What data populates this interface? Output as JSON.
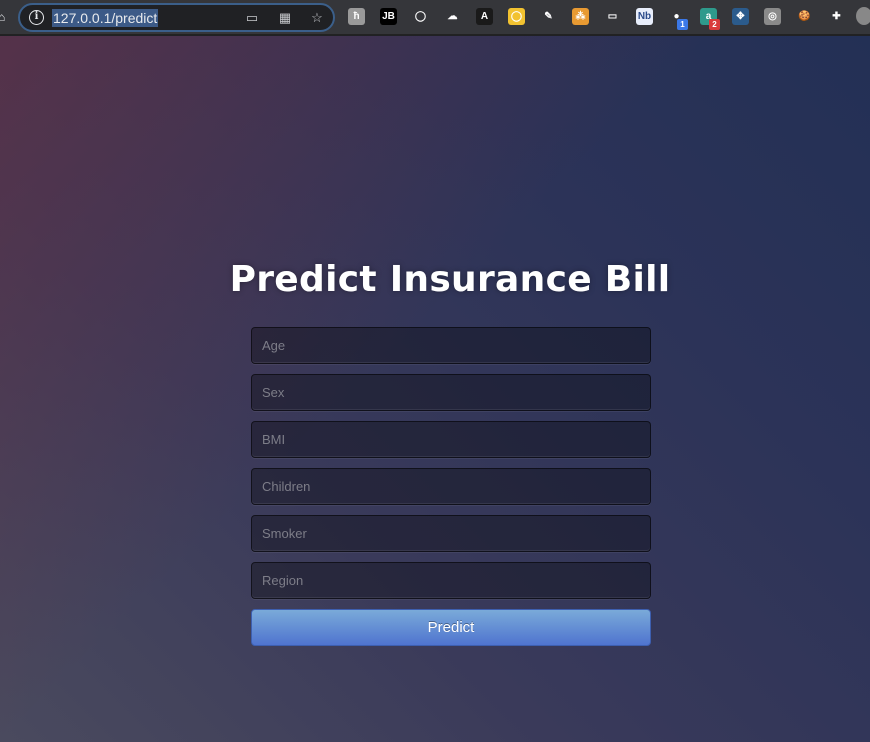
{
  "browser": {
    "url": "127.0.0.1/predict",
    "omnibox_icons": [
      "cast-device-icon",
      "qr-code-icon",
      "bookmark-star-icon"
    ],
    "extensions": [
      {
        "name": "hunter-extension",
        "glyph": "ħ",
        "bg": "#9a9a9a"
      },
      {
        "name": "jetbrains-extension",
        "glyph": "JB",
        "bg": "#000000"
      },
      {
        "name": "ring-extension",
        "glyph": "◯",
        "bg": "transparent"
      },
      {
        "name": "cloud-extension",
        "glyph": "☁",
        "bg": "transparent"
      },
      {
        "name": "adobe-extension",
        "glyph": "A",
        "bg": "#1a1a1a"
      },
      {
        "name": "sun-extension",
        "glyph": "◯",
        "bg": "#f2c230"
      },
      {
        "name": "dropper-extension",
        "glyph": "✎",
        "bg": "transparent"
      },
      {
        "name": "share-extension",
        "glyph": "⁂",
        "bg": "#e89a32"
      },
      {
        "name": "chat-extension",
        "glyph": "▭",
        "bg": "transparent"
      },
      {
        "name": "notebook-extension",
        "glyph": "Nb",
        "bg": "#e8eefb"
      },
      {
        "name": "green-dot-extension",
        "glyph": "●",
        "bg": "transparent",
        "badge": "1",
        "badge_color": "#3b78e7"
      },
      {
        "name": "a-extension",
        "glyph": "a",
        "bg": "#2e9a8c",
        "badge": "2",
        "badge_color": "#d93b3b"
      },
      {
        "name": "network-extension",
        "glyph": "✥",
        "bg": "#2b5b8c"
      },
      {
        "name": "gray-extension",
        "glyph": "◎",
        "bg": "#8a8a8a"
      },
      {
        "name": "cookie-extension",
        "glyph": "🍪",
        "bg": "transparent"
      },
      {
        "name": "puzzle-extension",
        "glyph": "✚",
        "bg": "transparent"
      }
    ]
  },
  "page": {
    "title": "Predict Insurance Bill",
    "fields": [
      {
        "name": "age",
        "placeholder": "Age",
        "value": ""
      },
      {
        "name": "sex",
        "placeholder": "Sex",
        "value": ""
      },
      {
        "name": "bmi",
        "placeholder": "BMI",
        "value": ""
      },
      {
        "name": "children",
        "placeholder": "Children",
        "value": ""
      },
      {
        "name": "smoker",
        "placeholder": "Smoker",
        "value": ""
      },
      {
        "name": "region",
        "placeholder": "Region",
        "value": ""
      }
    ],
    "submit_label": "Predict"
  },
  "colors": {
    "button_top": "#7aaad9",
    "button_bottom": "#4f74cf",
    "bg_top_left": "#5a3a4e",
    "bg_bottom_right": "#233055"
  }
}
